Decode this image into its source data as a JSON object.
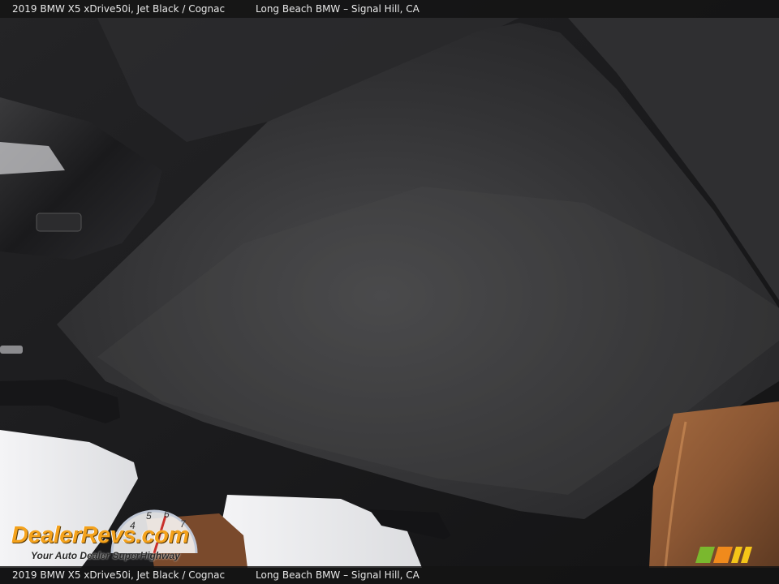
{
  "caption": {
    "vehicle": "2019 BMW X5 xDrive50i,   Jet Black / Cognac",
    "dealer": "Long Beach BMW – Signal Hill, CA"
  },
  "watermark": {
    "brand": "DealerRevs.com",
    "tagline": "Your Auto Dealer SuperHighway",
    "gauge_numbers": [
      "4",
      "5",
      "6",
      "7"
    ]
  },
  "colors": {
    "headliner": "#2b2b2d",
    "leather": "#8a5633",
    "logo_orange": "#f4a21c"
  }
}
